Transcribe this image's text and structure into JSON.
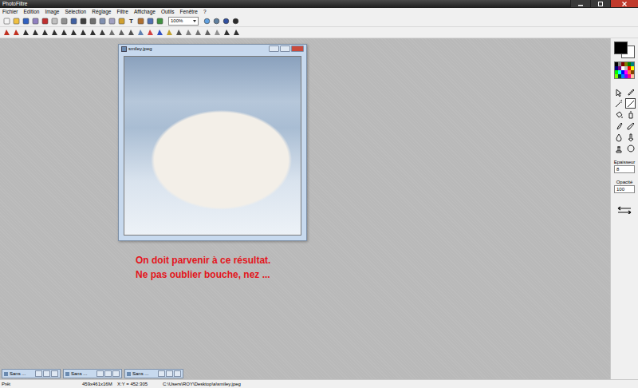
{
  "window": {
    "title": "PhotoFiltre"
  },
  "menu": [
    "Fichier",
    "Edition",
    "Image",
    "Sélection",
    "Réglage",
    "Filtre",
    "Affichage",
    "Outils",
    "Fenêtre",
    "?"
  ],
  "toolbar": {
    "zoom": "100%",
    "text_tool": "T"
  },
  "palette": {
    "foreground": "#000000",
    "background": "#ffffff",
    "colors": [
      "#000000",
      "#808080",
      "#800000",
      "#808000",
      "#008000",
      "#008080",
      "#000080",
      "#800080",
      "#ffffff",
      "#c0c0c0",
      "#ff0000",
      "#ffff00",
      "#00ff00",
      "#00ffff",
      "#0000ff",
      "#ff00ff",
      "#ff8040",
      "#804000",
      "#80ff00",
      "#004040",
      "#0080ff",
      "#8000ff",
      "#ff0080",
      "#ffc0a0"
    ]
  },
  "tools": [
    {
      "selected": false
    },
    {
      "selected": false
    },
    {
      "selected": false
    },
    {
      "selected": true
    },
    {
      "selected": false
    },
    {
      "selected": false
    },
    {
      "selected": false
    },
    {
      "selected": false
    },
    {
      "selected": false
    },
    {
      "selected": false
    },
    {
      "selected": false
    },
    {
      "selected": false
    }
  ],
  "tool_options": [
    {
      "label": "Epaisseur",
      "value": "8"
    },
    {
      "label": "Opacité",
      "value": "100"
    }
  ],
  "image_window": {
    "title": "smiley.jpeg"
  },
  "annotation": [
    "On doit parvenir à ce résultat.",
    "Ne pas oublier bouche, nez ..."
  ],
  "minimized_windows": [
    {
      "title": "Sans ..."
    },
    {
      "title": "Sans ..."
    },
    {
      "title": "Sans ..."
    }
  ],
  "status_bar": {
    "state": "Prêt",
    "size": "459x461x16M",
    "cursor": "X:Y = 452:305",
    "path": "C:\\Users\\ROY\\Desktop\\a\\smiley.jpeg"
  }
}
